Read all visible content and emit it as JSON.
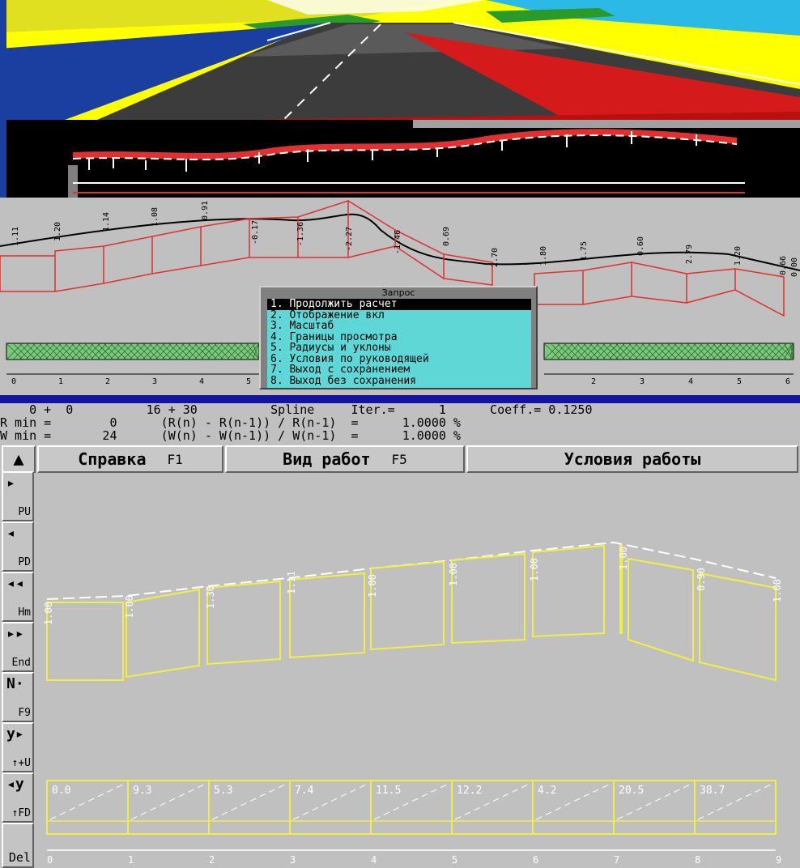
{
  "profile_labels": [
    "1.11",
    "1.20",
    "1.14",
    "1.08",
    "0.91",
    "-0.17",
    "-1.36",
    "-2.27",
    "-1.46",
    "0.69",
    "2.70",
    "1.80",
    "1.75",
    "0.60",
    "2.79",
    "1.20",
    "0.66",
    "0.00"
  ],
  "profile_ruler": [
    "0",
    "1",
    "2",
    "3",
    "4",
    "5",
    "6"
  ],
  "profile_ruler_right": [
    "2",
    "3",
    "4",
    "5",
    "6"
  ],
  "query": {
    "title": "Запрос",
    "items": [
      "1. Продолжить расчет",
      "2. Отображение вкл",
      "3. Масштаб",
      "4. Границы просмотра",
      "5. Радиусы и уклоны",
      "6. Условия по руководящей",
      "7. Выход с сохранением",
      "8. Выход без сохранения"
    ],
    "selected_index": 0
  },
  "status": {
    "line1": "    0 +  0          16 + 30          Spline     Iter.=      1      Coeff.= 0.1250",
    "line2": "R min =        0      (R(n) - R(n-1)) / R(n-1)  =      1.0000 %",
    "line3": "W min =       24      (W(n) - W(n-1)) / W(n-1)  =      1.0000 %"
  },
  "menu": {
    "help_label": "Справка",
    "help_key": "F1",
    "work_label": "Вид работ",
    "work_key": "F5",
    "conditions_label": "Условия работы"
  },
  "toolbar": [
    {
      "glyph": "▸",
      "label": "PU"
    },
    {
      "glyph": "◂",
      "label": "PD"
    },
    {
      "glyph": "◂◂",
      "label": "Hm"
    },
    {
      "glyph": "▸▸",
      "label": "End"
    },
    {
      "glyph": "N·",
      "label": "F9"
    },
    {
      "glyph": "y▸",
      "label": "↑+U"
    },
    {
      "glyph": "◂y",
      "label": "↑FD"
    },
    {
      "glyph": "",
      "label": "Del"
    }
  ],
  "work_labels": [
    "1.00",
    "1.00",
    "1.30",
    "1.11",
    "1.00",
    "1.00",
    "1.00",
    "1.00",
    "0.90",
    "1.00"
  ],
  "work_bottom_values": [
    "0.0",
    "9.3",
    "5.3",
    "7.4",
    "11.5",
    "12.2",
    "4.2",
    "20.5",
    "38.7"
  ],
  "work_ruler": [
    "0",
    "1",
    "2",
    "3",
    "4",
    "5",
    "6",
    "7",
    "8",
    "9"
  ],
  "colors": {
    "panel_gray": "#c0c0c0",
    "profile_red": "#e03030",
    "work_yellow": "#f0f040",
    "dialog_cyan": "#5fd7d7",
    "divider_blue": "#1414a0"
  }
}
